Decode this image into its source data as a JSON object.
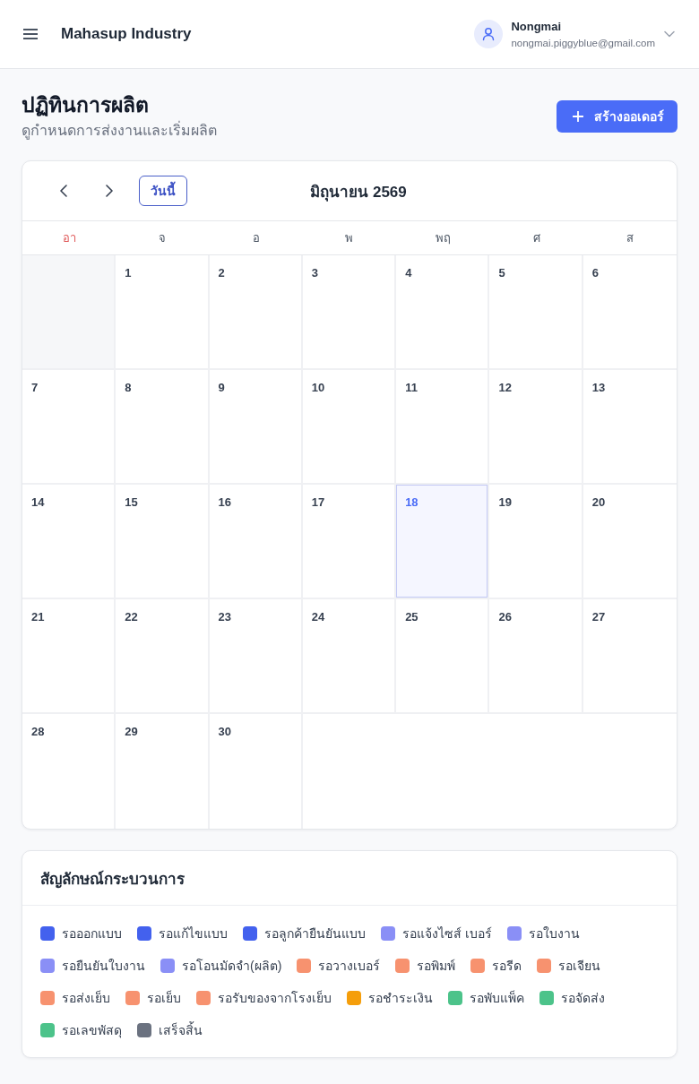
{
  "header": {
    "app_title": "Mahasup Industry",
    "user": {
      "name": "Nongmai",
      "email": "nongmai.piggyblue@gmail.com"
    }
  },
  "page": {
    "title": "ปฏิทินการผลิต",
    "subtitle": "ดูกำหนดการส่งงานและเริ่มผลิต",
    "create_button": "สร้างออเดอร์"
  },
  "calendar": {
    "today_button": "วันนี้",
    "month_title": "มิถุนายน 2569",
    "weekdays": [
      {
        "label": "อา",
        "kind": "sunday"
      },
      {
        "label": "จ",
        "kind": "weekday"
      },
      {
        "label": "อ",
        "kind": "weekday"
      },
      {
        "label": "พ",
        "kind": "weekday"
      },
      {
        "label": "พฤ",
        "kind": "weekday"
      },
      {
        "label": "ศ",
        "kind": "weekday"
      },
      {
        "label": "ส",
        "kind": "weekday"
      }
    ],
    "weeks": [
      [
        {
          "kind": "blank"
        },
        {
          "kind": "day",
          "day": "1",
          "today": false
        },
        {
          "kind": "day",
          "day": "2",
          "today": false
        },
        {
          "kind": "day",
          "day": "3",
          "today": false
        },
        {
          "kind": "day",
          "day": "4",
          "today": false
        },
        {
          "kind": "day",
          "day": "5",
          "today": false
        },
        {
          "kind": "day",
          "day": "6",
          "today": false
        }
      ],
      [
        {
          "kind": "day",
          "day": "7",
          "today": false
        },
        {
          "kind": "day",
          "day": "8",
          "today": false
        },
        {
          "kind": "day",
          "day": "9",
          "today": false
        },
        {
          "kind": "day",
          "day": "10",
          "today": false
        },
        {
          "kind": "day",
          "day": "11",
          "today": false
        },
        {
          "kind": "day",
          "day": "12",
          "today": false
        },
        {
          "kind": "day",
          "day": "13",
          "today": false
        }
      ],
      [
        {
          "kind": "day",
          "day": "14",
          "today": false
        },
        {
          "kind": "day",
          "day": "15",
          "today": false
        },
        {
          "kind": "day",
          "day": "16",
          "today": false
        },
        {
          "kind": "day",
          "day": "17",
          "today": false
        },
        {
          "kind": "day",
          "day": "18",
          "today": true
        },
        {
          "kind": "day",
          "day": "19",
          "today": false
        },
        {
          "kind": "day",
          "day": "20",
          "today": false
        }
      ],
      [
        {
          "kind": "day",
          "day": "21",
          "today": false
        },
        {
          "kind": "day",
          "day": "22",
          "today": false
        },
        {
          "kind": "day",
          "day": "23",
          "today": false
        },
        {
          "kind": "day",
          "day": "24",
          "today": false
        },
        {
          "kind": "day",
          "day": "25",
          "today": false
        },
        {
          "kind": "day",
          "day": "26",
          "today": false
        },
        {
          "kind": "day",
          "day": "27",
          "today": false
        }
      ],
      [
        {
          "kind": "day",
          "day": "28",
          "today": false
        },
        {
          "kind": "day",
          "day": "29",
          "today": false
        },
        {
          "kind": "day",
          "day": "30",
          "today": false
        }
      ]
    ]
  },
  "legend": {
    "title": "สัญลักษณ์กระบวนการ",
    "items": [
      {
        "label": "รอออกแบบ",
        "color": "#4361ee"
      },
      {
        "label": "รอแก้ไขแบบ",
        "color": "#4361ee"
      },
      {
        "label": "รอลูกค้ายืนยันแบบ",
        "color": "#4361ee"
      },
      {
        "label": "รอแจ้งไซส์ เบอร์",
        "color": "#8a8ff6"
      },
      {
        "label": "รอใบงาน",
        "color": "#8a8ff6"
      },
      {
        "label": "รอยืนยันใบงาน",
        "color": "#8a8ff6"
      },
      {
        "label": "รอโอนมัดจำ(ผลิต)",
        "color": "#8a8ff6"
      },
      {
        "label": "รอวางเบอร์",
        "color": "#f7926f"
      },
      {
        "label": "รอพิมพ์",
        "color": "#f7926f"
      },
      {
        "label": "รอรีด",
        "color": "#f7926f"
      },
      {
        "label": "รอเจียน",
        "color": "#f7926f"
      },
      {
        "label": "รอส่งเย็บ",
        "color": "#f7926f"
      },
      {
        "label": "รอเย็บ",
        "color": "#f7926f"
      },
      {
        "label": "รอรับของจากโรงเย็บ",
        "color": "#f7926f"
      },
      {
        "label": "รอชำระเงิน",
        "color": "#f59e0b"
      },
      {
        "label": "รอพับแพ็ค",
        "color": "#4cc38a"
      },
      {
        "label": "รอจัดส่ง",
        "color": "#4cc38a"
      },
      {
        "label": "รอเลขพัสดุ",
        "color": "#4cc38a"
      },
      {
        "label": "เสร็จสิ้น",
        "color": "#6b7280"
      }
    ]
  }
}
